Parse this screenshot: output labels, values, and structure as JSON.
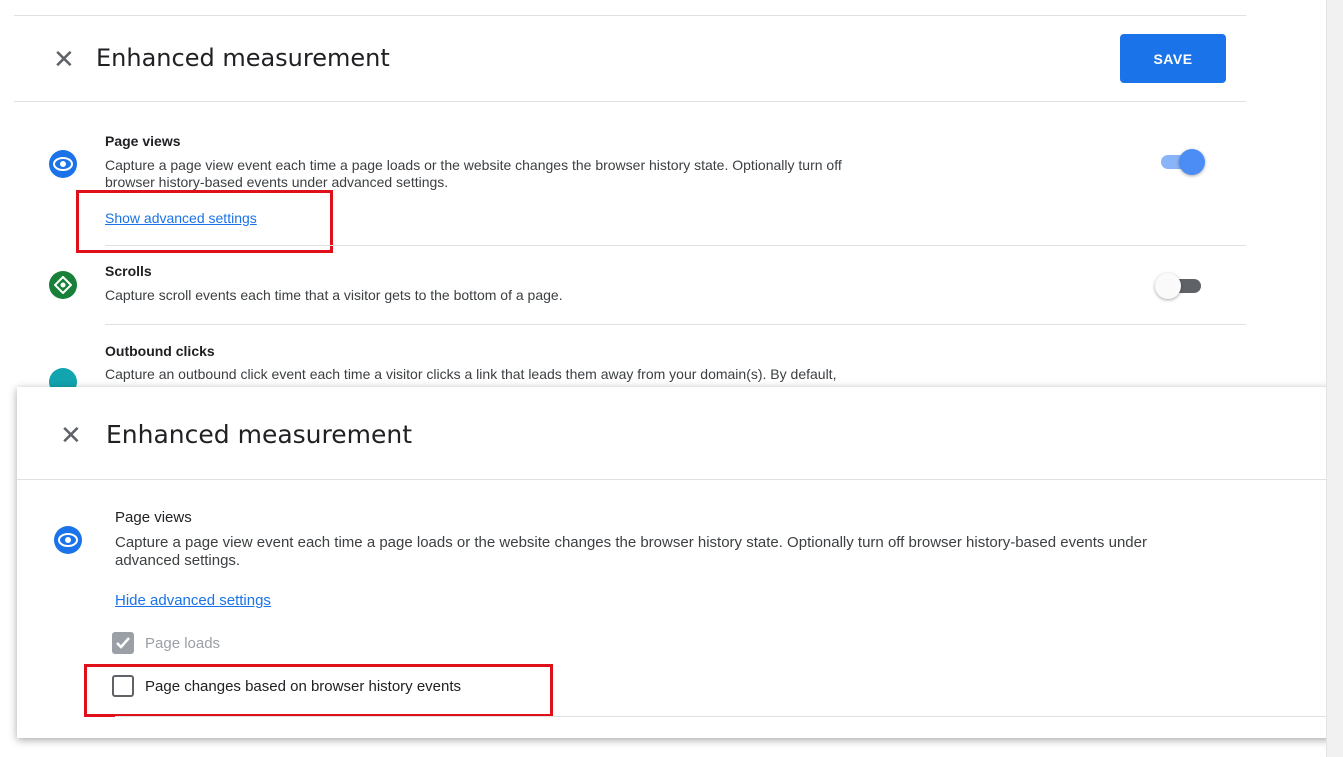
{
  "top": {
    "title": "Enhanced measurement",
    "save_label": "SAVE",
    "items": [
      {
        "title": "Page views",
        "desc_line1": "Capture a page view event each time a page loads or the website changes the browser history state. Optionally turn off",
        "desc_line2": "browser history-based events under advanced settings.",
        "link": "Show advanced settings",
        "enabled": true,
        "icon": "eye-icon",
        "color": "#1a73e8"
      },
      {
        "title": "Scrolls",
        "desc_line1": "Capture scroll events each time that a visitor gets to the bottom of a page.",
        "enabled": false,
        "icon": "scroll-icon",
        "color": "#188038"
      },
      {
        "title": "Outbound clicks",
        "desc_line1": "Capture an outbound click event each time a visitor clicks a link that leads them away from your domain(s). By default,",
        "icon": "outbound-icon",
        "color": "#12a4af"
      }
    ]
  },
  "bottom": {
    "title": "Enhanced measurement",
    "item": {
      "title": "Page views",
      "desc_line1": "Capture a page view event each time a page loads or the website changes the browser history state. Optionally turn off browser history-based events under",
      "desc_line2": "advanced settings.",
      "link": "Hide advanced settings",
      "icon": "eye-icon",
      "color": "#1a73e8"
    },
    "options": [
      {
        "label": "Page loads",
        "checked": true,
        "disabled": true
      },
      {
        "label": "Page changes based on browser history events",
        "checked": false,
        "disabled": false
      }
    ]
  },
  "colors": {
    "accent": "#1a73e8",
    "highlight": "#e0101a"
  }
}
